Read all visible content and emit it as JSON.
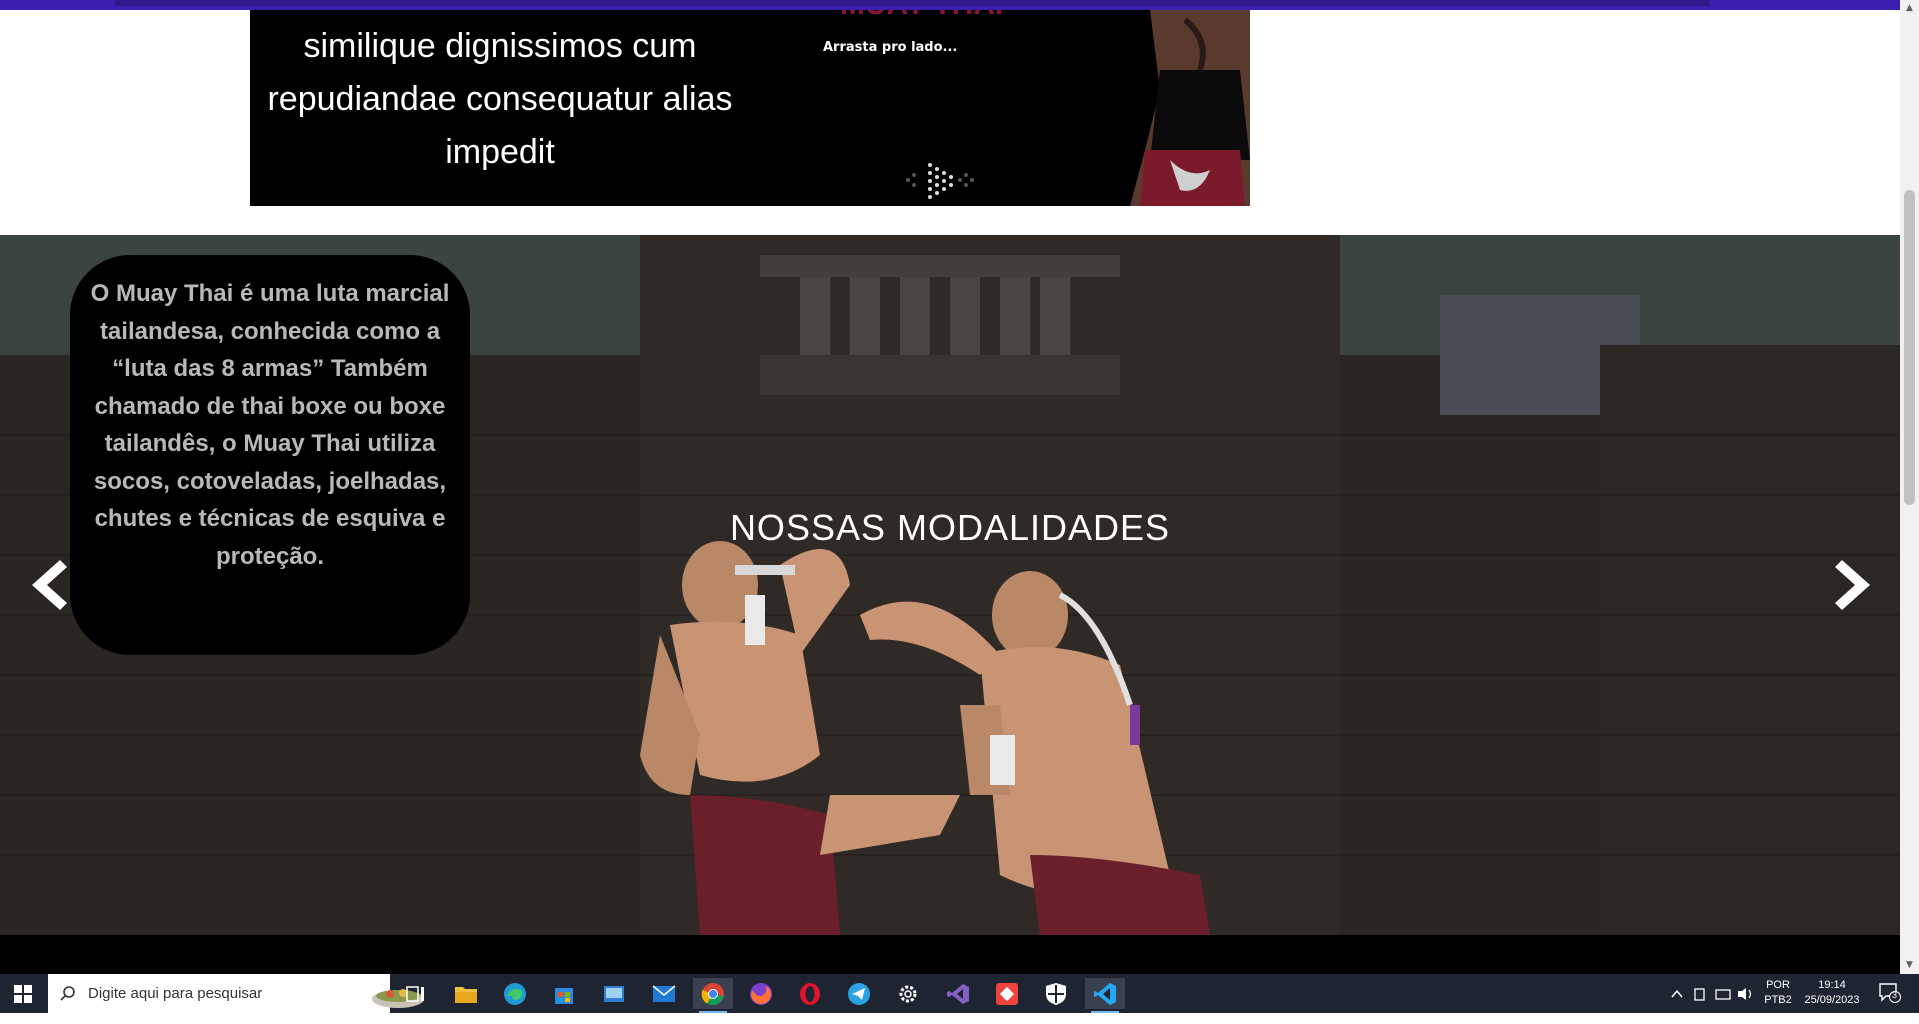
{
  "banner": {
    "text": "similique dignissimos cum repudiandae consequatur alias impedit",
    "heading_partial": "MUAY THAI",
    "hint": "Arrasta pro lado..."
  },
  "hero": {
    "info_text": "O Muay Thai é uma luta marcial tailandesa, conhecida como a “luta das 8 armas” Também chamado de thai boxe ou boxe tailandês, o Muay Thai utiliza socos, cotoveladas, joelhadas, chutes e técnicas de esquiva e proteção.",
    "title": "NOSSAS MODALIDADES",
    "prev_icon": "chevron-left-icon",
    "next_icon": "chevron-right-icon"
  },
  "taskbar": {
    "search_placeholder": "Digite aqui para pesquisar",
    "apps": [
      "task-view",
      "file-explorer",
      "edge",
      "store",
      "paint",
      "mail",
      "chrome",
      "firefox",
      "opera",
      "telegram",
      "settings",
      "visual-studio",
      "anydesk",
      "defender",
      "vscode"
    ],
    "lang_line1": "POR",
    "lang_line2": "PTB2",
    "time": "19:14",
    "date": "25/09/2023",
    "notifications": "3"
  },
  "colors": {
    "topbar": "#3b1fae",
    "banner_bg": "#000000",
    "card_bg": "#000000",
    "taskbar_bg": "#1f2433"
  }
}
